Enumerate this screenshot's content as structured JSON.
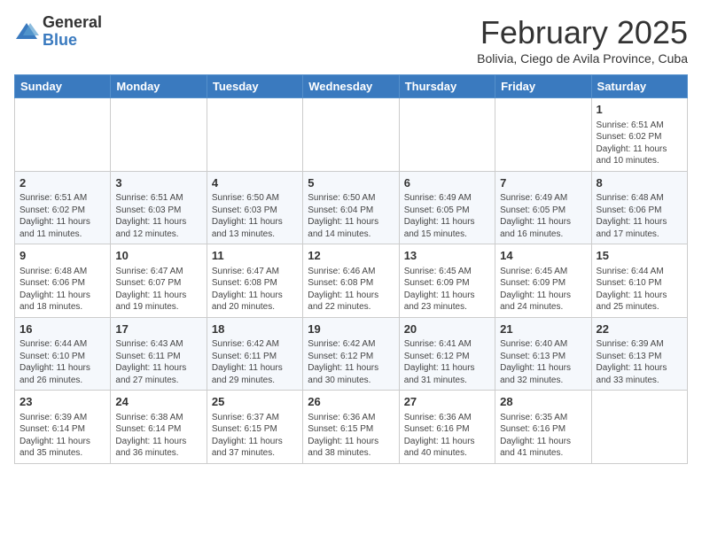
{
  "logo": {
    "general": "General",
    "blue": "Blue"
  },
  "header": {
    "month_year": "February 2025",
    "location": "Bolivia, Ciego de Avila Province, Cuba"
  },
  "weekdays": [
    "Sunday",
    "Monday",
    "Tuesday",
    "Wednesday",
    "Thursday",
    "Friday",
    "Saturday"
  ],
  "weeks": [
    [
      {
        "day": "",
        "info": ""
      },
      {
        "day": "",
        "info": ""
      },
      {
        "day": "",
        "info": ""
      },
      {
        "day": "",
        "info": ""
      },
      {
        "day": "",
        "info": ""
      },
      {
        "day": "",
        "info": ""
      },
      {
        "day": "1",
        "info": "Sunrise: 6:51 AM\nSunset: 6:02 PM\nDaylight: 11 hours\nand 10 minutes."
      }
    ],
    [
      {
        "day": "2",
        "info": "Sunrise: 6:51 AM\nSunset: 6:02 PM\nDaylight: 11 hours\nand 11 minutes."
      },
      {
        "day": "3",
        "info": "Sunrise: 6:51 AM\nSunset: 6:03 PM\nDaylight: 11 hours\nand 12 minutes."
      },
      {
        "day": "4",
        "info": "Sunrise: 6:50 AM\nSunset: 6:03 PM\nDaylight: 11 hours\nand 13 minutes."
      },
      {
        "day": "5",
        "info": "Sunrise: 6:50 AM\nSunset: 6:04 PM\nDaylight: 11 hours\nand 14 minutes."
      },
      {
        "day": "6",
        "info": "Sunrise: 6:49 AM\nSunset: 6:05 PM\nDaylight: 11 hours\nand 15 minutes."
      },
      {
        "day": "7",
        "info": "Sunrise: 6:49 AM\nSunset: 6:05 PM\nDaylight: 11 hours\nand 16 minutes."
      },
      {
        "day": "8",
        "info": "Sunrise: 6:48 AM\nSunset: 6:06 PM\nDaylight: 11 hours\nand 17 minutes."
      }
    ],
    [
      {
        "day": "9",
        "info": "Sunrise: 6:48 AM\nSunset: 6:06 PM\nDaylight: 11 hours\nand 18 minutes."
      },
      {
        "day": "10",
        "info": "Sunrise: 6:47 AM\nSunset: 6:07 PM\nDaylight: 11 hours\nand 19 minutes."
      },
      {
        "day": "11",
        "info": "Sunrise: 6:47 AM\nSunset: 6:08 PM\nDaylight: 11 hours\nand 20 minutes."
      },
      {
        "day": "12",
        "info": "Sunrise: 6:46 AM\nSunset: 6:08 PM\nDaylight: 11 hours\nand 22 minutes."
      },
      {
        "day": "13",
        "info": "Sunrise: 6:45 AM\nSunset: 6:09 PM\nDaylight: 11 hours\nand 23 minutes."
      },
      {
        "day": "14",
        "info": "Sunrise: 6:45 AM\nSunset: 6:09 PM\nDaylight: 11 hours\nand 24 minutes."
      },
      {
        "day": "15",
        "info": "Sunrise: 6:44 AM\nSunset: 6:10 PM\nDaylight: 11 hours\nand 25 minutes."
      }
    ],
    [
      {
        "day": "16",
        "info": "Sunrise: 6:44 AM\nSunset: 6:10 PM\nDaylight: 11 hours\nand 26 minutes."
      },
      {
        "day": "17",
        "info": "Sunrise: 6:43 AM\nSunset: 6:11 PM\nDaylight: 11 hours\nand 27 minutes."
      },
      {
        "day": "18",
        "info": "Sunrise: 6:42 AM\nSunset: 6:11 PM\nDaylight: 11 hours\nand 29 minutes."
      },
      {
        "day": "19",
        "info": "Sunrise: 6:42 AM\nSunset: 6:12 PM\nDaylight: 11 hours\nand 30 minutes."
      },
      {
        "day": "20",
        "info": "Sunrise: 6:41 AM\nSunset: 6:12 PM\nDaylight: 11 hours\nand 31 minutes."
      },
      {
        "day": "21",
        "info": "Sunrise: 6:40 AM\nSunset: 6:13 PM\nDaylight: 11 hours\nand 32 minutes."
      },
      {
        "day": "22",
        "info": "Sunrise: 6:39 AM\nSunset: 6:13 PM\nDaylight: 11 hours\nand 33 minutes."
      }
    ],
    [
      {
        "day": "23",
        "info": "Sunrise: 6:39 AM\nSunset: 6:14 PM\nDaylight: 11 hours\nand 35 minutes."
      },
      {
        "day": "24",
        "info": "Sunrise: 6:38 AM\nSunset: 6:14 PM\nDaylight: 11 hours\nand 36 minutes."
      },
      {
        "day": "25",
        "info": "Sunrise: 6:37 AM\nSunset: 6:15 PM\nDaylight: 11 hours\nand 37 minutes."
      },
      {
        "day": "26",
        "info": "Sunrise: 6:36 AM\nSunset: 6:15 PM\nDaylight: 11 hours\nand 38 minutes."
      },
      {
        "day": "27",
        "info": "Sunrise: 6:36 AM\nSunset: 6:16 PM\nDaylight: 11 hours\nand 40 minutes."
      },
      {
        "day": "28",
        "info": "Sunrise: 6:35 AM\nSunset: 6:16 PM\nDaylight: 11 hours\nand 41 minutes."
      },
      {
        "day": "",
        "info": ""
      }
    ]
  ]
}
